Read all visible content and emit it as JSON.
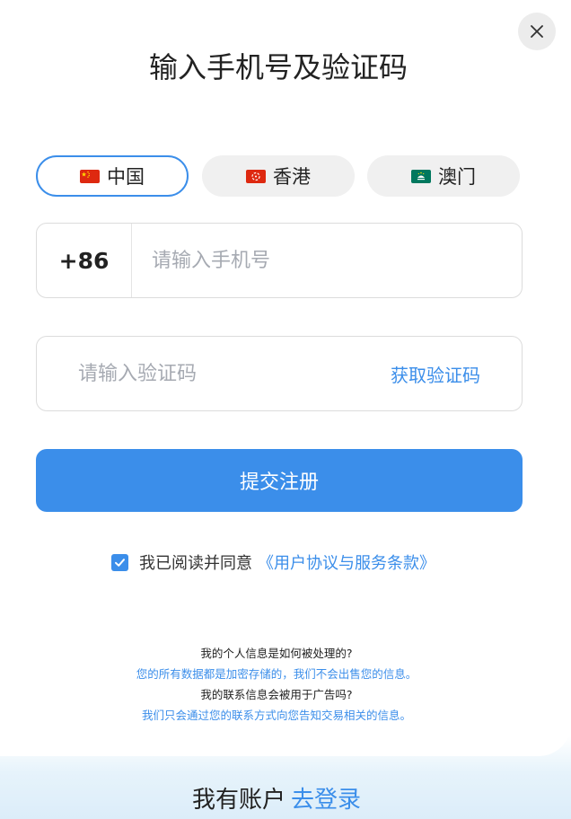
{
  "header": {
    "title": "输入手机号及验证码",
    "close_icon": "close-icon"
  },
  "region_tabs": [
    {
      "label": "中国",
      "flag": "china-flag-icon",
      "selected": true
    },
    {
      "label": "香港",
      "flag": "hongkong-flag-icon",
      "selected": false
    },
    {
      "label": "澳门",
      "flag": "macau-flag-icon",
      "selected": false
    }
  ],
  "phone": {
    "prefix": "+86",
    "value": "",
    "placeholder": "请输入手机号"
  },
  "code": {
    "value": "",
    "placeholder": "请输入验证码",
    "get_code_label": "获取验证码"
  },
  "submit_label": "提交注册",
  "agreement": {
    "checked": true,
    "text": "我已阅读并同意",
    "link": "《用户协议与服务条款》"
  },
  "faq": [
    {
      "q": "我的个人信息是如何被处理的?",
      "a": "您的所有数据都是加密存储的，我们不会出售您的信息。"
    },
    {
      "q": "我的联系信息会被用于广告吗?",
      "a": "我们只会通过您的联系方式向您告知交易相关的信息。"
    }
  ],
  "footer": {
    "text": "我有账户",
    "link": "去登录"
  },
  "colors": {
    "accent": "#3b8eea",
    "placeholder": "#a6aab2",
    "tab_bg": "#f0f0f0"
  }
}
